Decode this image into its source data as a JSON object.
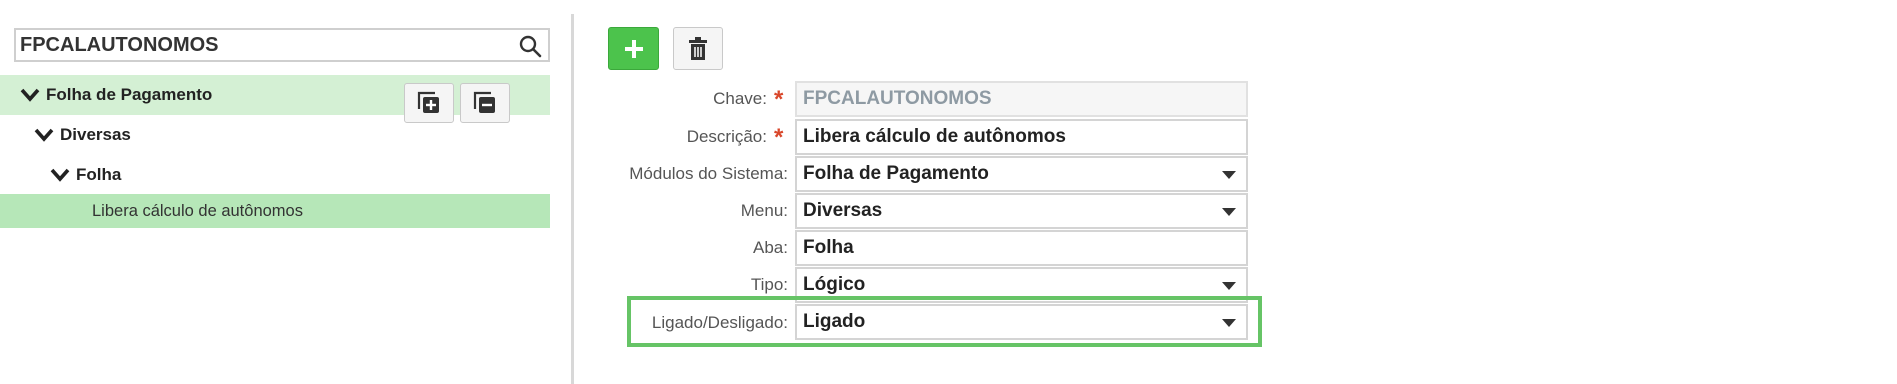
{
  "search": {
    "value": "FPCALAUTONOMOS"
  },
  "tree": {
    "root": "Folha de Pagamento",
    "level1": "Diversas",
    "level2": "Folha",
    "leaf": "Libera cálculo de autônomos"
  },
  "colors": {
    "add_button": "#4cc34c",
    "selected_row": "#b6e7b8",
    "root_row": "#d4f0d4",
    "highlight": "#66c466",
    "required": "#d9472b"
  },
  "form": {
    "chave": {
      "label": "Chave:",
      "value": "FPCALAUTONOMOS",
      "required": true
    },
    "descricao": {
      "label": "Descrição:",
      "value": "Libera cálculo de autônomos",
      "required": true
    },
    "modulos": {
      "label": "Módulos do Sistema:",
      "value": "Folha de Pagamento"
    },
    "menu": {
      "label": "Menu:",
      "value": "Diversas"
    },
    "aba": {
      "label": "Aba:",
      "value": "Folha"
    },
    "tipo": {
      "label": "Tipo:",
      "value": "Lógico"
    },
    "ligado": {
      "label": "Ligado/Desligado:",
      "value": "Ligado"
    }
  },
  "required_mark": "*"
}
